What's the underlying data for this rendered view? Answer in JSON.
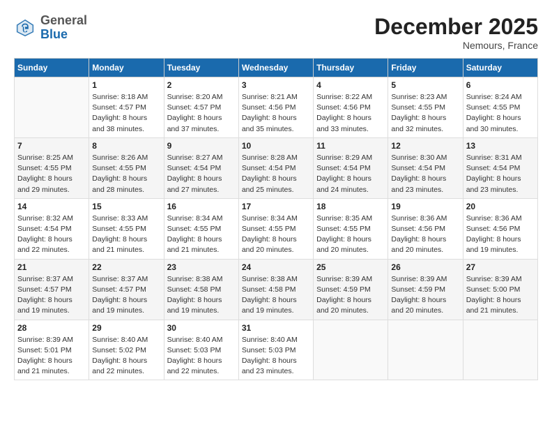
{
  "header": {
    "logo_line1": "General",
    "logo_line2": "Blue",
    "month_title": "December 2025",
    "location": "Nemours, France"
  },
  "weekdays": [
    "Sunday",
    "Monday",
    "Tuesday",
    "Wednesday",
    "Thursday",
    "Friday",
    "Saturday"
  ],
  "weeks": [
    [
      {
        "day": "",
        "info": ""
      },
      {
        "day": "1",
        "info": "Sunrise: 8:18 AM\nSunset: 4:57 PM\nDaylight: 8 hours\nand 38 minutes."
      },
      {
        "day": "2",
        "info": "Sunrise: 8:20 AM\nSunset: 4:57 PM\nDaylight: 8 hours\nand 37 minutes."
      },
      {
        "day": "3",
        "info": "Sunrise: 8:21 AM\nSunset: 4:56 PM\nDaylight: 8 hours\nand 35 minutes."
      },
      {
        "day": "4",
        "info": "Sunrise: 8:22 AM\nSunset: 4:56 PM\nDaylight: 8 hours\nand 33 minutes."
      },
      {
        "day": "5",
        "info": "Sunrise: 8:23 AM\nSunset: 4:55 PM\nDaylight: 8 hours\nand 32 minutes."
      },
      {
        "day": "6",
        "info": "Sunrise: 8:24 AM\nSunset: 4:55 PM\nDaylight: 8 hours\nand 30 minutes."
      }
    ],
    [
      {
        "day": "7",
        "info": "Sunrise: 8:25 AM\nSunset: 4:55 PM\nDaylight: 8 hours\nand 29 minutes."
      },
      {
        "day": "8",
        "info": "Sunrise: 8:26 AM\nSunset: 4:55 PM\nDaylight: 8 hours\nand 28 minutes."
      },
      {
        "day": "9",
        "info": "Sunrise: 8:27 AM\nSunset: 4:54 PM\nDaylight: 8 hours\nand 27 minutes."
      },
      {
        "day": "10",
        "info": "Sunrise: 8:28 AM\nSunset: 4:54 PM\nDaylight: 8 hours\nand 25 minutes."
      },
      {
        "day": "11",
        "info": "Sunrise: 8:29 AM\nSunset: 4:54 PM\nDaylight: 8 hours\nand 24 minutes."
      },
      {
        "day": "12",
        "info": "Sunrise: 8:30 AM\nSunset: 4:54 PM\nDaylight: 8 hours\nand 23 minutes."
      },
      {
        "day": "13",
        "info": "Sunrise: 8:31 AM\nSunset: 4:54 PM\nDaylight: 8 hours\nand 23 minutes."
      }
    ],
    [
      {
        "day": "14",
        "info": "Sunrise: 8:32 AM\nSunset: 4:54 PM\nDaylight: 8 hours\nand 22 minutes."
      },
      {
        "day": "15",
        "info": "Sunrise: 8:33 AM\nSunset: 4:55 PM\nDaylight: 8 hours\nand 21 minutes."
      },
      {
        "day": "16",
        "info": "Sunrise: 8:34 AM\nSunset: 4:55 PM\nDaylight: 8 hours\nand 21 minutes."
      },
      {
        "day": "17",
        "info": "Sunrise: 8:34 AM\nSunset: 4:55 PM\nDaylight: 8 hours\nand 20 minutes."
      },
      {
        "day": "18",
        "info": "Sunrise: 8:35 AM\nSunset: 4:55 PM\nDaylight: 8 hours\nand 20 minutes."
      },
      {
        "day": "19",
        "info": "Sunrise: 8:36 AM\nSunset: 4:56 PM\nDaylight: 8 hours\nand 20 minutes."
      },
      {
        "day": "20",
        "info": "Sunrise: 8:36 AM\nSunset: 4:56 PM\nDaylight: 8 hours\nand 19 minutes."
      }
    ],
    [
      {
        "day": "21",
        "info": "Sunrise: 8:37 AM\nSunset: 4:57 PM\nDaylight: 8 hours\nand 19 minutes."
      },
      {
        "day": "22",
        "info": "Sunrise: 8:37 AM\nSunset: 4:57 PM\nDaylight: 8 hours\nand 19 minutes."
      },
      {
        "day": "23",
        "info": "Sunrise: 8:38 AM\nSunset: 4:58 PM\nDaylight: 8 hours\nand 19 minutes."
      },
      {
        "day": "24",
        "info": "Sunrise: 8:38 AM\nSunset: 4:58 PM\nDaylight: 8 hours\nand 19 minutes."
      },
      {
        "day": "25",
        "info": "Sunrise: 8:39 AM\nSunset: 4:59 PM\nDaylight: 8 hours\nand 20 minutes."
      },
      {
        "day": "26",
        "info": "Sunrise: 8:39 AM\nSunset: 4:59 PM\nDaylight: 8 hours\nand 20 minutes."
      },
      {
        "day": "27",
        "info": "Sunrise: 8:39 AM\nSunset: 5:00 PM\nDaylight: 8 hours\nand 21 minutes."
      }
    ],
    [
      {
        "day": "28",
        "info": "Sunrise: 8:39 AM\nSunset: 5:01 PM\nDaylight: 8 hours\nand 21 minutes."
      },
      {
        "day": "29",
        "info": "Sunrise: 8:40 AM\nSunset: 5:02 PM\nDaylight: 8 hours\nand 22 minutes."
      },
      {
        "day": "30",
        "info": "Sunrise: 8:40 AM\nSunset: 5:03 PM\nDaylight: 8 hours\nand 22 minutes."
      },
      {
        "day": "31",
        "info": "Sunrise: 8:40 AM\nSunset: 5:03 PM\nDaylight: 8 hours\nand 23 minutes."
      },
      {
        "day": "",
        "info": ""
      },
      {
        "day": "",
        "info": ""
      },
      {
        "day": "",
        "info": ""
      }
    ]
  ]
}
